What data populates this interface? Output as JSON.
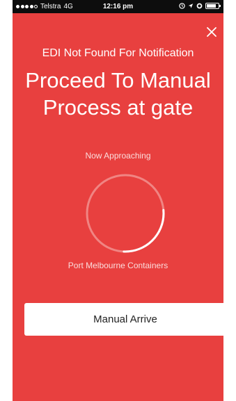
{
  "status_bar": {
    "carrier": "Telstra",
    "network": "4G",
    "time": "12:16 pm",
    "signal_strength_filled": 4,
    "signal_strength_total": 5,
    "icons": [
      "alarm-icon",
      "location-arrow-icon",
      "bluetooth-icon",
      "battery-icon"
    ]
  },
  "close": {
    "icon": "close-icon"
  },
  "notification": {
    "subtitle": "EDI Not Found For Notification",
    "title": "Proceed To Manual Process at gate"
  },
  "approach": {
    "label": "Now Approaching",
    "location": "Port Melbourne Containers",
    "progress": 0.27
  },
  "actions": {
    "manual_arrive": "Manual Arrive"
  },
  "colors": {
    "background": "#e8403f",
    "ring_track": "#f08583",
    "ring_progress": "#ffffff",
    "button": "#ffffff"
  }
}
